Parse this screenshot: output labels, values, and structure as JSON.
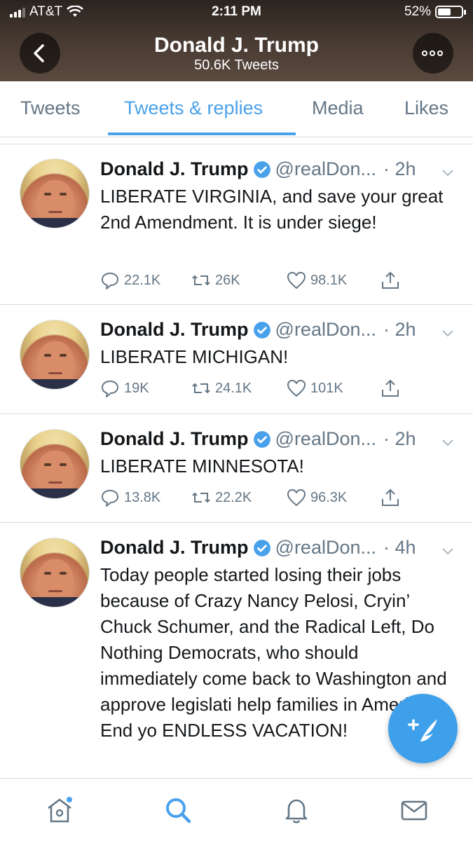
{
  "status_bar": {
    "carrier": "AT&T",
    "time": "2:11 PM",
    "battery": "52%"
  },
  "header": {
    "name": "Donald J. Trump",
    "tweet_count": "50.6K Tweets"
  },
  "tabs": [
    {
      "label": "Tweets",
      "active": false
    },
    {
      "label": "Tweets & replies",
      "active": true
    },
    {
      "label": "Media",
      "active": false
    },
    {
      "label": "Likes",
      "active": false
    }
  ],
  "tweets": [
    {
      "author": "Donald J. Trump",
      "handle": "@realDon...",
      "time": "· 2h",
      "text": "LIBERATE VIRGINIA, and save your great 2nd Amendment. It is under siege!",
      "replies": "22.1K",
      "retweets": "26K",
      "likes": "98.1K"
    },
    {
      "author": "Donald J. Trump",
      "handle": "@realDon...",
      "time": "· 2h",
      "text": "LIBERATE MICHIGAN!",
      "replies": "19K",
      "retweets": "24.1K",
      "likes": "101K"
    },
    {
      "author": "Donald J. Trump",
      "handle": "@realDon...",
      "time": "· 2h",
      "text": "LIBERATE MINNESOTA!",
      "replies": "13.8K",
      "retweets": "22.2K",
      "likes": "96.3K"
    },
    {
      "author": "Donald J. Trump",
      "handle": "@realDon...",
      "time": "· 4h",
      "text": "Today people started losing their jobs because of Crazy Nancy Pelosi, Cryin’ Chuck Schumer, and the Radical Left, Do Nothing Democrats, who should immediately come back to Washington and approve legislati help families in America. End yo ENDLESS VACATION!"
    }
  ],
  "colors": {
    "accent": "#4aa1eb",
    "header_bg": "#3a2f28",
    "muted": "#657786"
  },
  "icons": {
    "back": "chevron-left-icon",
    "more": "more-icon",
    "verified": "verified-badge-icon",
    "reply": "reply-icon",
    "retweet": "retweet-icon",
    "like": "heart-icon",
    "share": "share-icon",
    "compose": "compose-icon",
    "home": "home-icon",
    "search": "search-icon",
    "notifications": "bell-icon",
    "messages": "mail-icon"
  }
}
